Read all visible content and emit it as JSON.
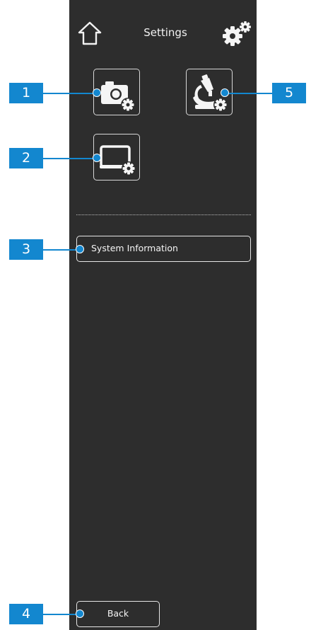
{
  "header": {
    "title": "Settings",
    "home_icon": "home-icon",
    "settings_icon": "gears-icon"
  },
  "tiles": [
    {
      "name": "camera-settings",
      "icon": "camera-gear-icon"
    },
    {
      "name": "microscope-settings",
      "icon": "microscope-gear-icon"
    },
    {
      "name": "display-settings",
      "icon": "monitor-gear-icon"
    }
  ],
  "buttons": {
    "system_information": "System Information",
    "back": "Back"
  },
  "callouts": [
    "1",
    "2",
    "3",
    "4",
    "5"
  ],
  "colors": {
    "panel": "#2d2d2d",
    "callout": "#1387cf",
    "text": "#f2f2f2"
  }
}
